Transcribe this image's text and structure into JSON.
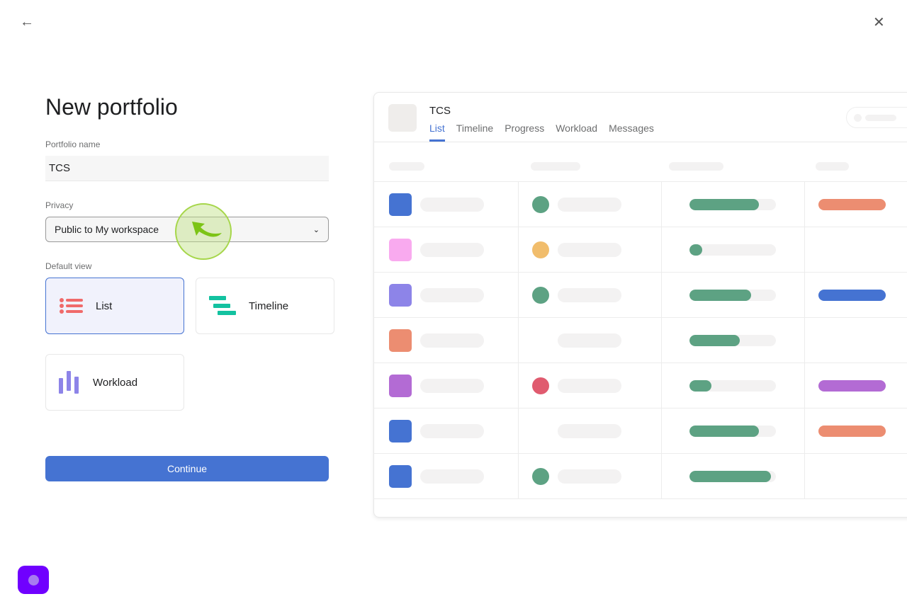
{
  "nav": {
    "back_icon": "arrow-left-icon",
    "close_icon": "close-icon"
  },
  "form": {
    "title": "New portfolio",
    "name_label": "Portfolio name",
    "name_value": "TCS",
    "privacy_label": "Privacy",
    "privacy_value": "Public to My workspace",
    "view_label": "Default view",
    "views": [
      {
        "label": "List",
        "icon": "list-icon",
        "selected": true
      },
      {
        "label": "Timeline",
        "icon": "timeline-icon",
        "selected": false
      },
      {
        "label": "Workload",
        "icon": "workload-icon",
        "selected": false
      }
    ],
    "continue_label": "Continue"
  },
  "preview": {
    "title": "TCS",
    "tabs": [
      "List",
      "Timeline",
      "Progress",
      "Workload",
      "Messages"
    ],
    "active_tab": "List",
    "rows": [
      {
        "square": "#4573d2",
        "dot": "#5da283",
        "progress": 0.8,
        "tag": "#ec8d71"
      },
      {
        "square": "#f9aaef",
        "dot": "#f1bd6c",
        "progress": 0.15,
        "tag": null
      },
      {
        "square": "#8d84e8",
        "dot": "#5da283",
        "progress": 0.71,
        "tag": "#4573d2"
      },
      {
        "square": "#ec8d71",
        "dot": null,
        "progress": 0.58,
        "tag": null
      },
      {
        "square": "#b36bd4",
        "dot": "#e05b6f",
        "progress": 0.25,
        "tag": "#b36bd4"
      },
      {
        "square": "#4573d2",
        "dot": null,
        "progress": 0.8,
        "tag": "#ec8d71"
      },
      {
        "square": "#4573d2",
        "dot": "#5da283",
        "progress": 0.94,
        "tag": null
      }
    ]
  },
  "colors": {
    "accent": "#4573d2",
    "help_button": "#7000ff"
  }
}
